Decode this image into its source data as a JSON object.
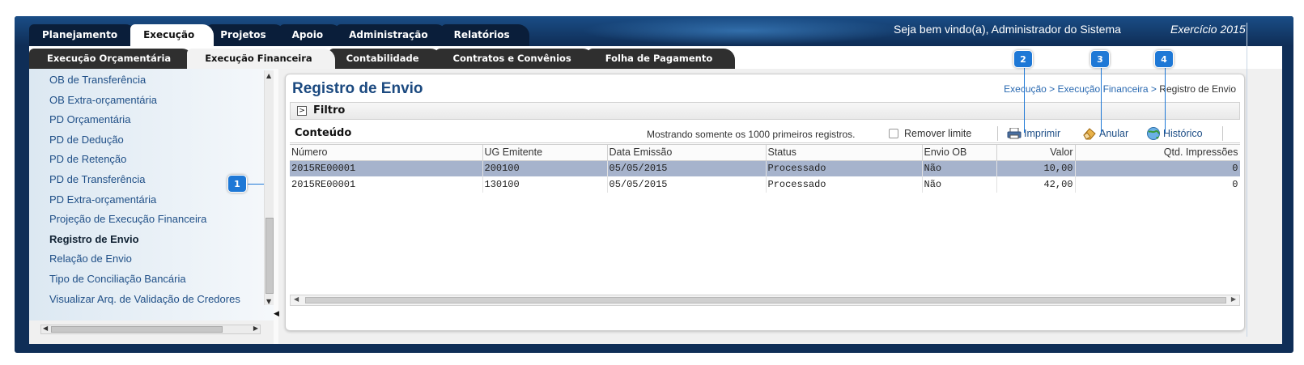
{
  "top_tabs": [
    {
      "label": "Planejamento",
      "active": false
    },
    {
      "label": "Execução",
      "active": true
    },
    {
      "label": "Projetos",
      "active": false
    },
    {
      "label": "Apoio",
      "active": false
    },
    {
      "label": "Administração",
      "active": false
    },
    {
      "label": "Relatórios",
      "active": false
    }
  ],
  "header": {
    "welcome": "Seja bem vindo(a), Administrador do Sistema",
    "exercicio": "Exercício 2015"
  },
  "sub_tabs": [
    {
      "label": "Execução Orçamentária",
      "active": false
    },
    {
      "label": "Execução Financeira",
      "active": true
    },
    {
      "label": "Contabilidade",
      "active": false
    },
    {
      "label": "Contratos e Convênios",
      "active": false
    },
    {
      "label": "Folha de Pagamento",
      "active": false
    }
  ],
  "sidebar": {
    "items": [
      {
        "label": "OB de Transferência"
      },
      {
        "label": "OB Extra-orçamentária"
      },
      {
        "label": "PD Orçamentária"
      },
      {
        "label": "PD de Dedução"
      },
      {
        "label": "PD de Retenção"
      },
      {
        "label": "PD de Transferência"
      },
      {
        "label": "PD Extra-orçamentária"
      },
      {
        "label": "Projeção de Execução Financeira"
      },
      {
        "label": "Registro de Envio"
      },
      {
        "label": "Relação de Envio"
      },
      {
        "label": "Tipo de Conciliação Bancária"
      },
      {
        "label": "Visualizar Arq. de Validação de Credores"
      }
    ],
    "current_index": 8
  },
  "main": {
    "title": "Registro de Envio",
    "breadcrumb": {
      "part1": "Execução",
      "sep": " > ",
      "part2": "Execução Financeira",
      "current": "Registro de Envio"
    },
    "filter_label": "Filtro",
    "filter_toggle": ">",
    "content_label": "Conteúdo",
    "showing_text": "Mostrando somente os 1000 primeiros registros.",
    "remove_limit_label": "Remover limite",
    "toolbar": {
      "print_label": "Imprimir",
      "cancel_label": "Anular",
      "history_label": "Histórico"
    }
  },
  "table": {
    "columns": [
      "Número",
      "UG Emitente",
      "Data Emissão",
      "Status",
      "Envio OB",
      "Valor",
      "Qtd. Impressões"
    ],
    "rows": [
      {
        "numero": "2015RE00001",
        "ug": "200100",
        "data": "05/05/2015",
        "status": "Processado",
        "envio_ob": "Não",
        "valor": "10,00",
        "qtd": "0",
        "selected": true
      },
      {
        "numero": "2015RE00001",
        "ug": "130100",
        "data": "05/05/2015",
        "status": "Processado",
        "envio_ob": "Não",
        "valor": "42,00",
        "qtd": "0",
        "selected": false
      }
    ]
  },
  "callouts": [
    "1",
    "2",
    "3",
    "4"
  ],
  "colors": {
    "frame": "#0f2e57",
    "accent_blue": "#1e78d6",
    "title_blue": "#1c4a80",
    "selected_row": "#a6b3cc"
  }
}
